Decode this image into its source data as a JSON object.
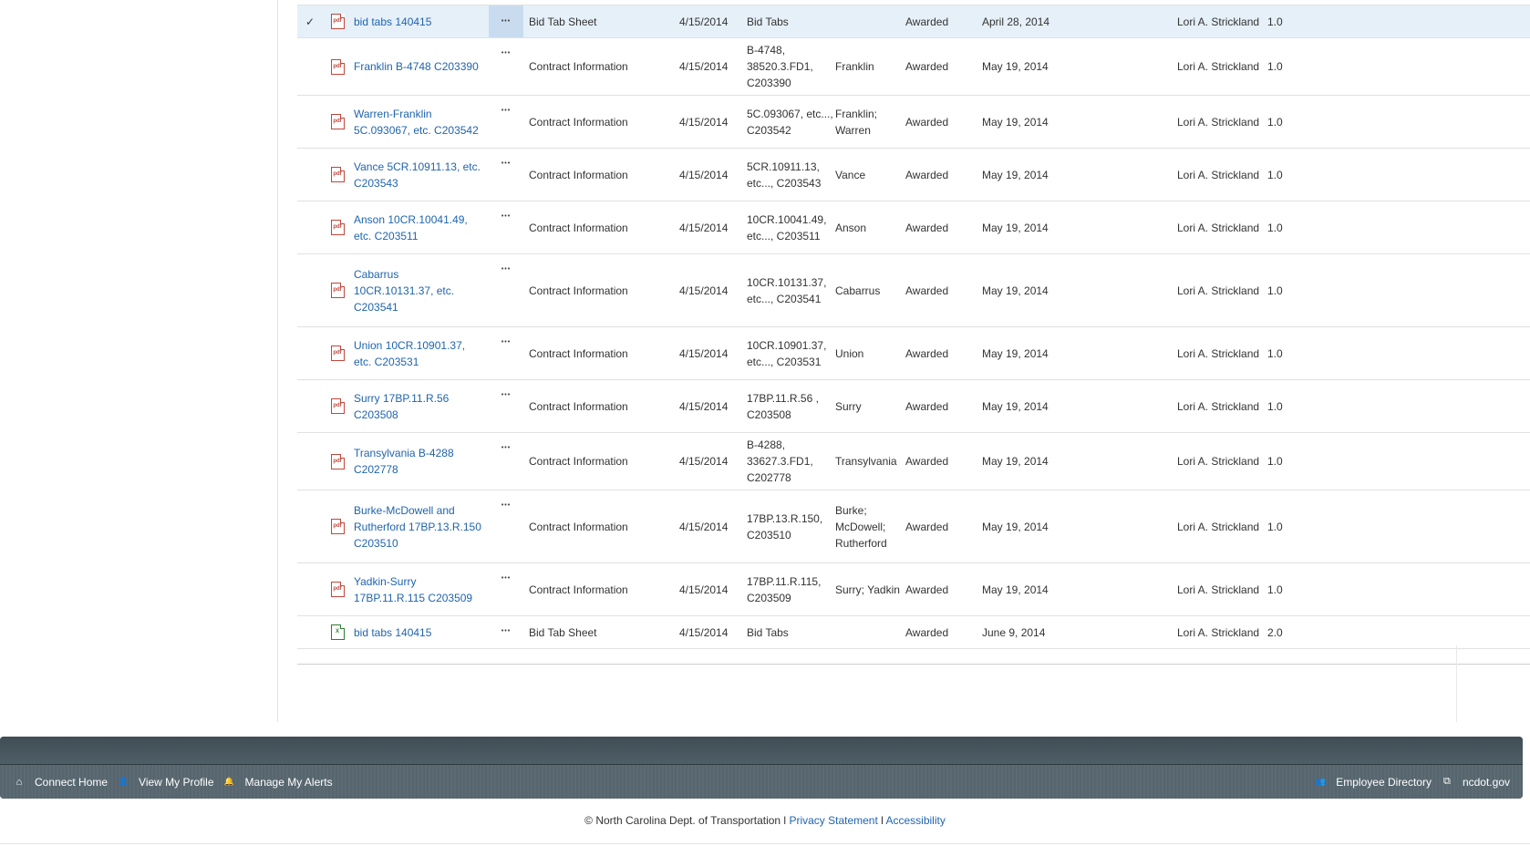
{
  "documents": [
    {
      "name": "bid tabs 140415",
      "file_type": "pdf",
      "doc_type": "Bid Tab Sheet",
      "date": "4/15/2014",
      "contract": "Bid Tabs",
      "county": "",
      "status": "Awarded",
      "let_date": "April 28, 2014",
      "author": "Lori A. Strickland",
      "version": "1.0",
      "selected": true,
      "check": "✓"
    },
    {
      "name": "Franklin B-4748 C203390",
      "file_type": "pdf",
      "doc_type": "Contract Information",
      "date": "4/15/2014",
      "contract": "B-4748, 38520.3.FD1, C203390",
      "county": "Franklin",
      "status": "Awarded",
      "let_date": "May 19, 2014",
      "author": "Lori A. Strickland",
      "version": "1.0"
    },
    {
      "name": "Warren-Franklin 5C.093067, etc. C203542",
      "file_type": "pdf",
      "doc_type": "Contract Information",
      "date": "4/15/2014",
      "contract": "5C.093067, etc..., C203542",
      "county": "Franklin; Warren",
      "status": "Awarded",
      "let_date": "May 19, 2014",
      "author": "Lori A. Strickland",
      "version": "1.0"
    },
    {
      "name": "Vance 5CR.10911.13, etc. C203543",
      "file_type": "pdf",
      "doc_type": "Contract Information",
      "date": "4/15/2014",
      "contract": "5CR.10911.13, etc..., C203543",
      "county": "Vance",
      "status": "Awarded",
      "let_date": "May 19, 2014",
      "author": "Lori A. Strickland",
      "version": "1.0"
    },
    {
      "name": "Anson 10CR.10041.49, etc. C203511",
      "file_type": "pdf",
      "doc_type": "Contract Information",
      "date": "4/15/2014",
      "contract": "10CR.10041.49, etc..., C203511",
      "county": "Anson",
      "status": "Awarded",
      "let_date": "May 19, 2014",
      "author": "Lori A. Strickland",
      "version": "1.0"
    },
    {
      "name": "Cabarrus 10CR.10131.37, etc. C203541",
      "file_type": "pdf",
      "doc_type": "Contract Information",
      "date": "4/15/2014",
      "contract": "10CR.10131.37, etc..., C203541",
      "county": "Cabarrus",
      "status": "Awarded",
      "let_date": "May 19, 2014",
      "author": "Lori A. Strickland",
      "version": "1.0"
    },
    {
      "name": "Union 10CR.10901.37, etc. C203531",
      "file_type": "pdf",
      "doc_type": "Contract Information",
      "date": "4/15/2014",
      "contract": "10CR.10901.37, etc..., C203531",
      "county": "Union",
      "status": "Awarded",
      "let_date": "May 19, 2014",
      "author": "Lori A. Strickland",
      "version": "1.0"
    },
    {
      "name": "Surry 17BP.11.R.56 C203508",
      "file_type": "pdf",
      "doc_type": "Contract Information",
      "date": "4/15/2014",
      "contract": "17BP.11.R.56 , C203508",
      "county": "Surry",
      "status": "Awarded",
      "let_date": "May 19, 2014",
      "author": "Lori A. Strickland",
      "version": "1.0"
    },
    {
      "name": "Transylvania B-4288 C202778",
      "file_type": "pdf",
      "doc_type": "Contract Information",
      "date": "4/15/2014",
      "contract": "B-4288, 33627.3.FD1, C202778",
      "county": "Transylvania",
      "status": "Awarded",
      "let_date": "May 19, 2014",
      "author": "Lori A. Strickland",
      "version": "1.0"
    },
    {
      "name": "Burke-McDowell and Rutherford 17BP.13.R.150 C203510",
      "file_type": "pdf",
      "doc_type": "Contract Information",
      "date": "4/15/2014",
      "contract": "17BP.13.R.150, C203510",
      "county": "Burke; McDowell; Rutherford",
      "status": "Awarded",
      "let_date": "May 19, 2014",
      "author": "Lori A. Strickland",
      "version": "1.0"
    },
    {
      "name": "Yadkin-Surry 17BP.11.R.115 C203509",
      "file_type": "pdf",
      "doc_type": "Contract Information",
      "date": "4/15/2014",
      "contract": "17BP.11.R.115, C203509",
      "county": "Surry; Yadkin",
      "status": "Awarded",
      "let_date": "May 19, 2014",
      "author": "Lori A. Strickland",
      "version": "1.0"
    },
    {
      "name": "bid tabs 140415",
      "file_type": "xls",
      "doc_type": "Bid Tab Sheet",
      "date": "4/15/2014",
      "contract": "Bid Tabs",
      "county": "",
      "status": "Awarded",
      "let_date": "June 9, 2014",
      "author": "Lori A. Strickland",
      "version": "2.0"
    }
  ],
  "icons": {
    "pdf_label": "pdf",
    "xls_label": "X",
    "ellipsis": "•••",
    "home": "⌂",
    "profile": "👤",
    "alerts": "🔔",
    "directory": "👥",
    "external": "⧉"
  },
  "footer": {
    "left_links": [
      "Connect Home",
      "View My Profile",
      "Manage My Alerts"
    ],
    "right_links": [
      "Employee Directory",
      "ncdot.gov"
    ]
  },
  "copyright": {
    "text": "© North Carolina Dept. of Transportation l ",
    "privacy": "Privacy Statement",
    "separator": " l ",
    "accessibility": "Accessibility"
  },
  "colors": {
    "link": "#1f64ad",
    "selected_row": "#e6f0f9",
    "footer_bar": "#4b5a63",
    "pdf_icon": "#c2463b",
    "xls_icon": "#2f7d32"
  }
}
